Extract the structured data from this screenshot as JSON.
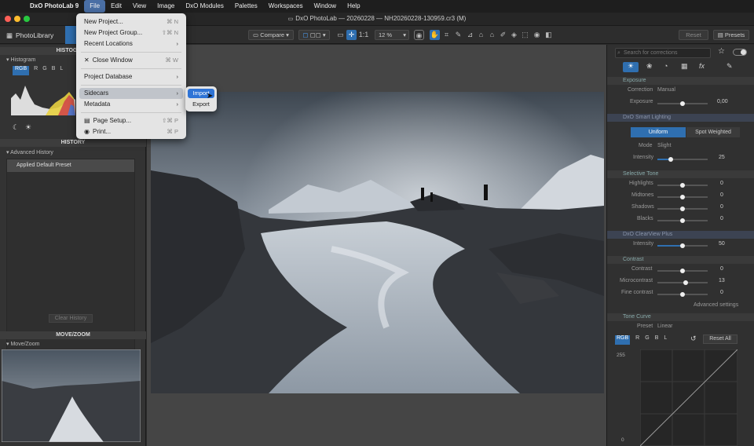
{
  "menubar": {
    "app": "DxO PhotoLab 9",
    "items": [
      "File",
      "Edit",
      "View",
      "Image",
      "DxO Modules",
      "Palettes",
      "Workspaces",
      "Window",
      "Help"
    ]
  },
  "window": {
    "title": "DxO PhotoLab — 20260228 — NH20260228-130959.cr3 (M)"
  },
  "toolbar": {
    "tab_library": "PhotoLibrary",
    "compare": "Compare",
    "zoom_fit": "1:1",
    "zoom": "12 %",
    "reset": "Reset",
    "presets": "Presets"
  },
  "file_menu": {
    "items": [
      {
        "label": "New Project...",
        "shortcut": "⌘ N"
      },
      {
        "label": "New Project Group...",
        "shortcut": "⇧⌘ N"
      },
      {
        "label": "Recent Locations",
        "shortcut": "›"
      },
      {
        "label": "Close Window",
        "shortcut": "⌘ W"
      },
      {
        "label": "Project Database",
        "shortcut": "›"
      },
      {
        "label": "Sidecars",
        "shortcut": "›"
      },
      {
        "label": "Metadata",
        "shortcut": "›"
      },
      {
        "label": "Page Setup...",
        "shortcut": "⇧⌘ P"
      },
      {
        "label": "Print...",
        "shortcut": "⌘ P"
      }
    ],
    "sidecars_submenu": [
      "Import",
      "Export"
    ]
  },
  "left_panel": {
    "histogram_title": "HISTOGRAM",
    "histogram_label": "Histogram",
    "channels": [
      "RGB",
      "R",
      "G",
      "B",
      "L"
    ],
    "history_title": "HISTORY",
    "advanced_history": "Advanced History",
    "history_item": "Applied Default Preset",
    "clear_history": "Clear History",
    "movezoom_title": "MOVE/ZOOM",
    "movezoom_label": "Move/Zoom"
  },
  "right_panel": {
    "search_placeholder": "Search for corrections",
    "exposure": {
      "title": "Exposure",
      "correction_label": "Correction",
      "correction_value": "Manual",
      "exposure_label": "Exposure",
      "exposure_value": "0,00",
      "exposure_level": 0.5
    },
    "smart_lighting": {
      "title": "DxO Smart Lighting",
      "mode_uniform": "Uniform",
      "mode_spot": "Spot Weighted",
      "mode_label": "Mode",
      "mode_value": "Slight",
      "intensity_label": "Intensity",
      "intensity_value": "25"
    },
    "selective_tone": {
      "title": "Selective Tone",
      "rows": [
        {
          "label": "Highlights",
          "value": "0"
        },
        {
          "label": "Midtones",
          "value": "0"
        },
        {
          "label": "Shadows",
          "value": "0"
        },
        {
          "label": "Blacks",
          "value": "0"
        }
      ]
    },
    "clearview": {
      "title": "DxO ClearView Plus",
      "intensity_label": "Intensity",
      "intensity_value": "50"
    },
    "contrast": {
      "title": "Contrast",
      "rows": [
        {
          "label": "Contrast",
          "value": "0"
        },
        {
          "label": "Microcontrast",
          "value": "13"
        },
        {
          "label": "Fine contrast",
          "value": "0"
        }
      ],
      "advanced": "Advanced settings"
    },
    "tone_curve": {
      "title": "Tone Curve",
      "preset_label": "Preset",
      "preset_value": "Linear",
      "channels": [
        "RGB",
        "R",
        "G",
        "B",
        "L"
      ],
      "reset_all": "Reset All",
      "max": "255",
      "min": "0"
    }
  }
}
